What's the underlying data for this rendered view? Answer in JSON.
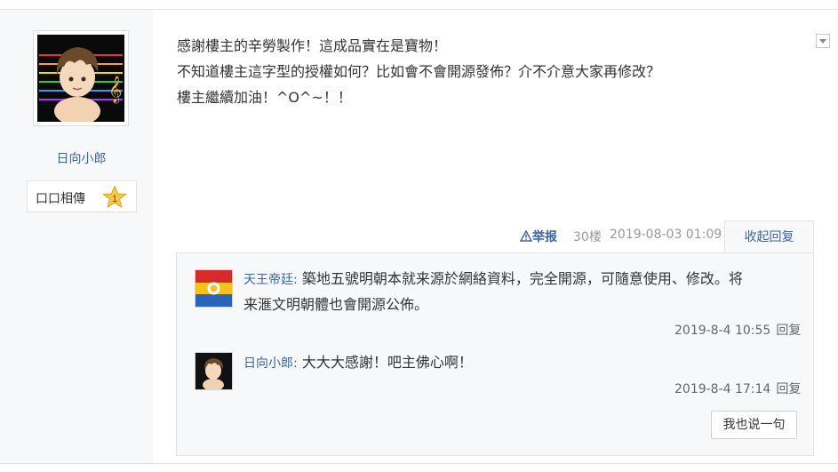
{
  "author": {
    "name": "日向小郎",
    "badge_label": "口口相傳",
    "badge_level": "1"
  },
  "post": {
    "lines": [
      "感謝樓主的辛勞製作！這成品實在是寶物！",
      "不知道樓主這字型的授權如何？比如會不會開源發佈？介不介意大家再修改？",
      "樓主繼續加油！^O^~！！"
    ],
    "report_label": "举报",
    "floor": "30楼",
    "time": "2019-08-03 01:09",
    "collapse_label": "收起回复"
  },
  "replies": [
    {
      "user": "天王帝廷",
      "text_line1": "築地五號明朝本就来源於網絡資料，完全開源，可隨意使用、修改。将",
      "text_line2": "来滙文明朝體也會開源公佈。",
      "time": "2019-8-4 10:55",
      "reply_label": "回复"
    },
    {
      "user": "日向小郎",
      "text_line1": "大大大感謝！吧主佛心啊！",
      "time": "2019-8-4 17:14",
      "reply_label": "回复"
    }
  ],
  "say_button": "我也说一句",
  "colors": {
    "link": "#3a64a8",
    "sidebar_bg": "#f7f8fa"
  }
}
